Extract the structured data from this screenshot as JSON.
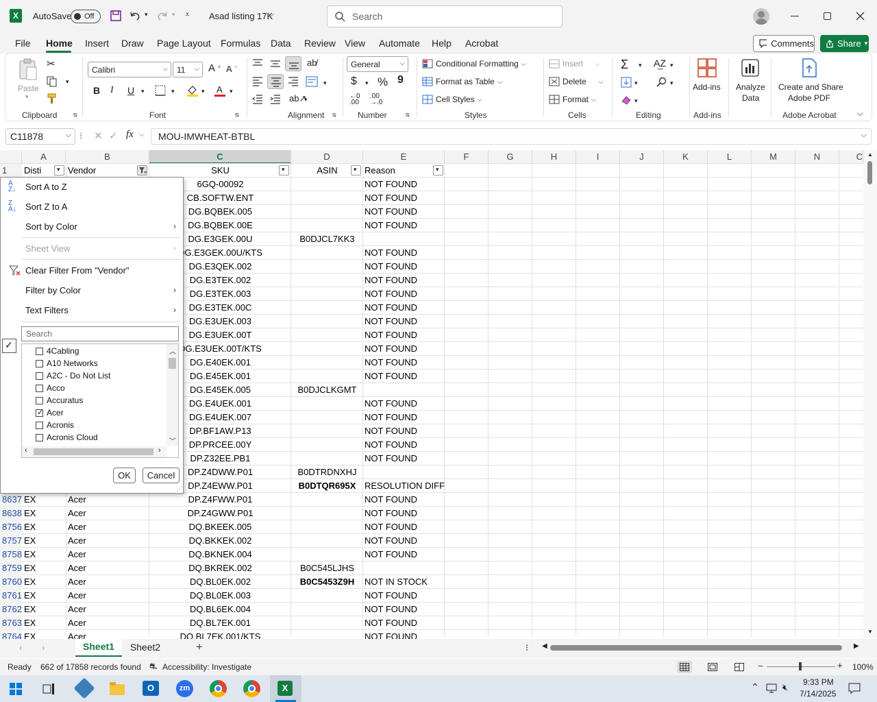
{
  "titlebar": {
    "autosave_label": "AutoSave",
    "toggle_state": "Off",
    "doc_title": "Asad listing 17K",
    "search_placeholder": "Search"
  },
  "menu": {
    "items": [
      "File",
      "Home",
      "Insert",
      "Draw",
      "Page Layout",
      "Formulas",
      "Data",
      "Review",
      "View",
      "Automate",
      "Help",
      "Acrobat"
    ],
    "comments": "Comments",
    "share": "Share"
  },
  "ribbon": {
    "clipboard": {
      "paste": "Paste",
      "label": "Clipboard"
    },
    "font": {
      "name": "Calibri",
      "size": "11",
      "label": "Font",
      "bold": "B",
      "italic": "I",
      "underline": "U"
    },
    "alignment": {
      "label": "Alignment"
    },
    "number": {
      "format": "General",
      "label": "Number",
      "currency": "$",
      "percent": "%",
      "comma": "9"
    },
    "styles": {
      "cond": "Conditional Formatting",
      "table": "Format as Table",
      "cell": "Cell Styles",
      "label": "Styles"
    },
    "cells": {
      "insert": "Insert",
      "delete": "Delete",
      "format": "Format",
      "label": "Cells"
    },
    "editing": {
      "label": "Editing"
    },
    "addins": {
      "btn": "Add-ins",
      "label": "Add-ins"
    },
    "analyze": {
      "line1": "Analyze",
      "line2": "Data"
    },
    "acrobat": {
      "line1": "Create and Share",
      "line2": "Adobe PDF",
      "label": "Adobe Acrobat"
    }
  },
  "formula": {
    "namebox": "C11878",
    "fx": "fx",
    "value": "MOU-IMWHEAT-BTBL"
  },
  "columns": [
    "A",
    "B",
    "C",
    "D",
    "E",
    "F",
    "G",
    "H",
    "I",
    "J",
    "K",
    "L",
    "M",
    "N",
    "C"
  ],
  "header_row": {
    "num": "1",
    "a": "Disti",
    "b": "Vendor",
    "c": "SKU",
    "d": "ASIN",
    "e": "Reason"
  },
  "rows_visible_under_menu": [
    {
      "sku": "6GQ-00092",
      "asin": "",
      "reason": "NOT FOUND"
    },
    {
      "sku": "CB.SOFTW.ENT",
      "asin": "",
      "reason": "NOT FOUND"
    },
    {
      "sku": "DG.BQBEK.005",
      "asin": "",
      "reason": "NOT FOUND"
    },
    {
      "sku": "DG.BQBEK.00E",
      "asin": "",
      "reason": "NOT FOUND"
    },
    {
      "sku": "DG.E3GEK.00U",
      "asin": "B0DJCL7KK3",
      "reason": ""
    },
    {
      "sku": "DG.E3GEK.00U/KTS",
      "asin": "",
      "reason": "NOT FOUND"
    },
    {
      "sku": "DG.E3QEK.002",
      "asin": "",
      "reason": "NOT FOUND"
    },
    {
      "sku": "DG.E3TEK.002",
      "asin": "",
      "reason": "NOT FOUND"
    },
    {
      "sku": "DG.E3TEK.003",
      "asin": "",
      "reason": "NOT FOUND"
    },
    {
      "sku": "DG.E3TEK.00C",
      "asin": "",
      "reason": "NOT FOUND"
    },
    {
      "sku": "DG.E3UEK.003",
      "asin": "",
      "reason": "NOT FOUND"
    },
    {
      "sku": "DG.E3UEK.00T",
      "asin": "",
      "reason": "NOT FOUND"
    },
    {
      "sku": "DG.E3UEK.00T/KTS",
      "asin": "",
      "reason": "NOT FOUND"
    },
    {
      "sku": "DG.E40EK.001",
      "asin": "",
      "reason": "NOT FOUND"
    },
    {
      "sku": "DG.E45EK.001",
      "asin": "",
      "reason": "NOT FOUND"
    },
    {
      "sku": "DG.E45EK.005",
      "asin": "B0DJCLKGMT",
      "reason": ""
    },
    {
      "sku": "DG.E4UEK.001",
      "asin": "",
      "reason": "NOT FOUND"
    },
    {
      "sku": "DG.E4UEK.007",
      "asin": "",
      "reason": "NOT FOUND"
    },
    {
      "sku": "DP.BF1AW.P13",
      "asin": "",
      "reason": "NOT FOUND"
    },
    {
      "sku": "DP.PRCEE.00Y",
      "asin": "",
      "reason": "NOT FOUND"
    },
    {
      "sku": "DP.Z32EE.PB1",
      "asin": "",
      "reason": "NOT FOUND"
    },
    {
      "sku": "DP.Z4DWW.P01",
      "asin": "B0DTRDNXHJ",
      "reason": ""
    },
    {
      "sku": "DP.Z4EWW.P01",
      "asin": "B0DTQR695X",
      "reason": "RESOLUTION DIFF",
      "bold": true
    }
  ],
  "rows_full": [
    {
      "num": "8637",
      "disti": "EX",
      "vendor": "Acer",
      "sku": "DP.Z4FWW.P01",
      "asin": "",
      "reason": "NOT FOUND"
    },
    {
      "num": "8638",
      "disti": "EX",
      "vendor": "Acer",
      "sku": "DP.Z4GWW.P01",
      "asin": "",
      "reason": "NOT FOUND"
    },
    {
      "num": "8756",
      "disti": "EX",
      "vendor": "Acer",
      "sku": "DQ.BKEEK.005",
      "asin": "",
      "reason": "NOT FOUND"
    },
    {
      "num": "8757",
      "disti": "EX",
      "vendor": "Acer",
      "sku": "DQ.BKKEK.002",
      "asin": "",
      "reason": "NOT FOUND"
    },
    {
      "num": "8758",
      "disti": "EX",
      "vendor": "Acer",
      "sku": "DQ.BKNEK.004",
      "asin": "",
      "reason": "NOT FOUND"
    },
    {
      "num": "8759",
      "disti": "EX",
      "vendor": "Acer",
      "sku": "DQ.BKREK.002",
      "asin": "B0C545LJHS",
      "reason": ""
    },
    {
      "num": "8760",
      "disti": "EX",
      "vendor": "Acer",
      "sku": "DQ.BL0EK.002",
      "asin": "B0C5453Z9H",
      "reason": "NOT IN STOCK",
      "bold": true
    },
    {
      "num": "8761",
      "disti": "EX",
      "vendor": "Acer",
      "sku": "DQ.BL0EK.003",
      "asin": "",
      "reason": "NOT FOUND"
    },
    {
      "num": "8762",
      "disti": "EX",
      "vendor": "Acer",
      "sku": "DQ.BL6EK.004",
      "asin": "",
      "reason": "NOT FOUND"
    },
    {
      "num": "8763",
      "disti": "EX",
      "vendor": "Acer",
      "sku": "DQ.BL7EK.001",
      "asin": "",
      "reason": "NOT FOUND"
    },
    {
      "num": "8764",
      "disti": "EX",
      "vendor": "Acer",
      "sku": "DQ.BL7EK.001/KTS",
      "asin": "",
      "reason": "NOT FOUND"
    }
  ],
  "filter_menu": {
    "sort_az": "Sort A to Z",
    "sort_za": "Sort Z to A",
    "sort_color": "Sort by Color",
    "sheet_view": "Sheet View",
    "clear_filter": "Clear Filter From \"Vendor\"",
    "filter_color": "Filter by Color",
    "text_filters": "Text Filters",
    "search_placeholder": "Search",
    "items": [
      {
        "label": "4Cabling",
        "checked": false
      },
      {
        "label": "A10 Networks",
        "checked": false
      },
      {
        "label": "A2C - Do Not List",
        "checked": false
      },
      {
        "label": "Acco",
        "checked": false
      },
      {
        "label": "Accuratus",
        "checked": false
      },
      {
        "label": "Acer",
        "checked": true
      },
      {
        "label": "Acronis",
        "checked": false
      },
      {
        "label": "Acronis Cloud",
        "checked": false
      }
    ],
    "ok": "OK",
    "cancel": "Cancel"
  },
  "sheets": [
    "Sheet1",
    "Sheet2"
  ],
  "status": {
    "ready": "Ready",
    "records": "662 of 17858 records found",
    "accessibility": "Accessibility: Investigate",
    "zoom": "100%"
  },
  "taskbar": {
    "time": "9:33 PM",
    "date": "7/14/2025"
  },
  "colors": {
    "excel_green": "#107c41",
    "row_blue": "#1f4ea8"
  }
}
